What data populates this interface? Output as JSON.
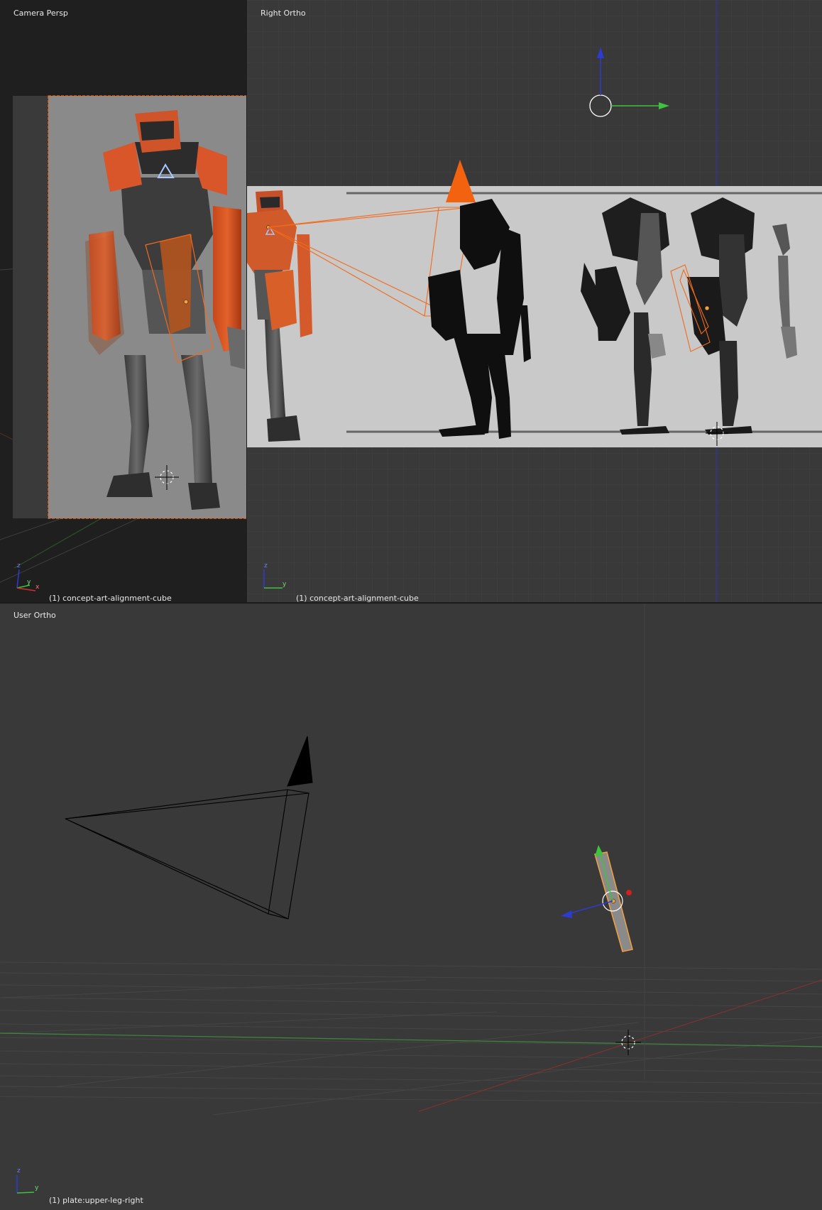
{
  "viewports": {
    "camera": {
      "title": "Camera Persp",
      "object_label": "(1) concept-art-alignment-cube",
      "axes": {
        "z": "z",
        "y": "y",
        "x": "x"
      }
    },
    "right": {
      "title": "Right Ortho",
      "object_label": "(1) concept-art-alignment-cube",
      "axes": {
        "z": "z",
        "y": "y"
      }
    },
    "user": {
      "title": "User Ortho",
      "object_label": "(1) plate:upper-leg-right",
      "axes": {
        "z": "z",
        "y": "y"
      }
    }
  },
  "colors": {
    "viewport_bg": "#393939",
    "camera_passepartout": "#1f1f1f",
    "selection": "#f26a1b",
    "axis_x": "#d03030",
    "axis_y": "#3fc23f",
    "axis_z": "#2d3bd0",
    "reference_bg": "#c9c9c9",
    "silhouette": "#0f0f0f"
  }
}
